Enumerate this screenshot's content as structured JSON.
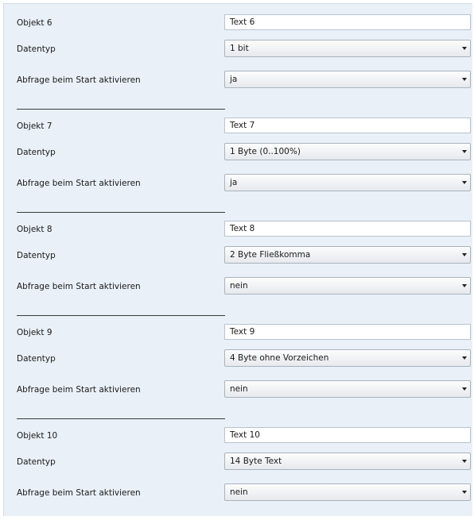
{
  "groups": [
    {
      "object_label": "Objekt 6",
      "text_value": "Text 6",
      "datatype_label": "Datentyp",
      "datatype_value": "1 bit",
      "query_label": "Abfrage beim Start aktivieren",
      "query_value": "ja"
    },
    {
      "object_label": "Objekt 7",
      "text_value": "Text 7",
      "datatype_label": "Datentyp",
      "datatype_value": "1 Byte (0..100%)",
      "query_label": "Abfrage beim Start aktivieren",
      "query_value": "ja"
    },
    {
      "object_label": "Objekt 8",
      "text_value": "Text 8",
      "datatype_label": "Datentyp",
      "datatype_value": "2 Byte Fließkomma",
      "query_label": "Abfrage beim Start aktivieren",
      "query_value": "nein"
    },
    {
      "object_label": "Objekt 9",
      "text_value": "Text 9",
      "datatype_label": "Datentyp",
      "datatype_value": "4 Byte ohne Vorzeichen",
      "query_label": "Abfrage beim Start aktivieren",
      "query_value": "nein"
    },
    {
      "object_label": "Objekt 10",
      "text_value": "Text 10",
      "datatype_label": "Datentyp",
      "datatype_value": "14 Byte Text",
      "query_label": "Abfrage beim Start aktivieren",
      "query_value": "nein"
    }
  ],
  "colors": {
    "panel_background": "#e9f0f8",
    "separator": "#3b3b3b"
  },
  "icons": {
    "dropdown": "chevron-down-icon"
  }
}
